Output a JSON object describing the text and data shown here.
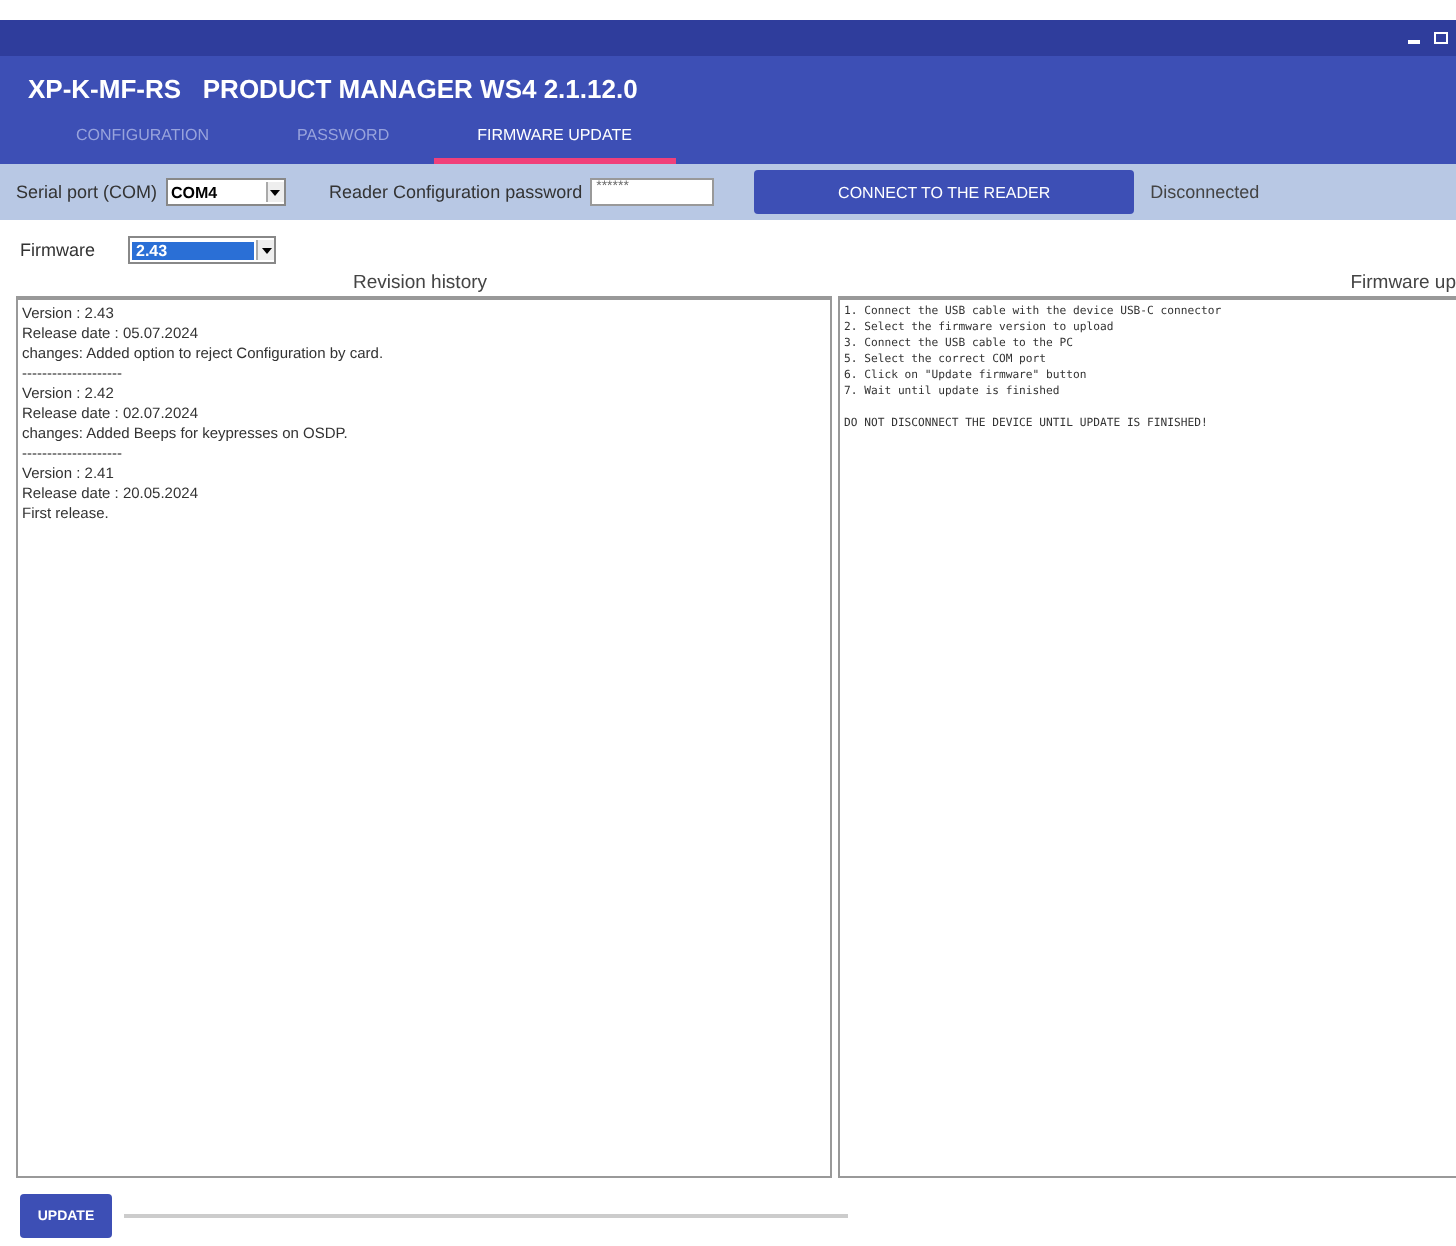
{
  "window": {
    "title": "XP-K-MF-RS   PRODUCT MANAGER WS4 2.1.12.0"
  },
  "tabs": [
    {
      "label": "CONFIGURATION",
      "selected": false
    },
    {
      "label": "PASSWORD",
      "selected": false
    },
    {
      "label": "FIRMWARE UPDATE",
      "selected": true
    }
  ],
  "toolbar": {
    "serial_port_label": "Serial port (COM)",
    "serial_port_value": "COM4",
    "password_label": "Reader Configuration password",
    "password_value": "******",
    "connect_button": "CONNECT TO THE READER",
    "status": "Disconnected"
  },
  "firmware": {
    "label": "Firmware",
    "value": "2.43"
  },
  "revision_history": {
    "heading": "Revision history",
    "lines": [
      "Version : 2.43",
      "Release date : 05.07.2024",
      "changes: Added option to reject Configuration by card.",
      "--------------------",
      "Version : 2.42",
      "Release date : 02.07.2024",
      "changes: Added Beeps for keypresses on OSDP.",
      "--------------------",
      "Version : 2.41",
      "Release date : 20.05.2024",
      "First release."
    ]
  },
  "firmware_update": {
    "heading": "Firmware up",
    "lines": [
      "1. Connect the USB cable with the device USB-C connector",
      "2. Select the firmware version to upload",
      "3. Connect the USB cable to the PC",
      "5. Select the correct COM port",
      "6. Click on \"Update firmware\" button",
      "7. Wait until update is finished"
    ],
    "warning": "DO NOT DISCONNECT THE DEVICE UNTIL UPDATE IS FINISHED!"
  },
  "update_button": "UPDATE",
  "progress": {
    "level": 0
  }
}
